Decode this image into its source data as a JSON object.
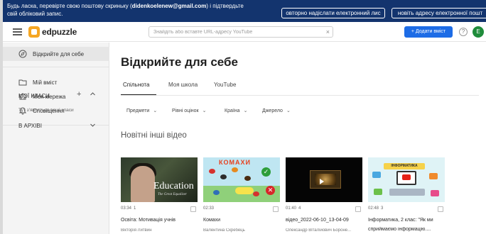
{
  "banner": {
    "text_before": "Будь ласка, перевірте свою поштову скриньку (",
    "email": "didenkoelenew@gmail.com",
    "text_after": ") і підтвердьте свій обліковий запис.",
    "resend_button": "овторно надіслати електронний лис",
    "change_button": "новіть адресу електронної пошт"
  },
  "header": {
    "logo_text": "edpuzzle",
    "search_placeholder": "Знайдіть або вставте URL-адресу YouTube",
    "search_clear": "×",
    "add_content_button": "+ Додати вміст",
    "help": "?",
    "avatar_letter": "E"
  },
  "sidebar": {
    "discover": "Відкрийте для себе",
    "my_content": "Мій вміст",
    "my_network": "Моя мережа",
    "notifications": "Сповіщення",
    "classes_title": "МОЇ КЛАСИ",
    "classes_plus": "+",
    "classes_hint": "Тут з'являться ваші класи",
    "archive": "В АРХІВІ"
  },
  "main": {
    "title": "Відкрийте для себе",
    "tabs": [
      {
        "label": "Спільнота"
      },
      {
        "label": "Моя школа"
      },
      {
        "label": "YouTube"
      }
    ],
    "filters": [
      {
        "label": "Предмети"
      },
      {
        "label": "Рівні оцінок"
      },
      {
        "label": "Країна"
      },
      {
        "label": "Джерело"
      }
    ],
    "section_title": "Новітні інші відео"
  },
  "videos": [
    {
      "duration": "03:34",
      "count": "1",
      "title": "Освіта: Мотивація учнів",
      "author": "Вікторія Литвин",
      "thumb_text": "Education",
      "thumb_sub": "The Great Equalizer"
    },
    {
      "duration": "02:33",
      "count": "",
      "title": "Комахи",
      "author": "Валентина Скребець",
      "thumb_text": "КОМАХИ"
    },
    {
      "duration": "01:40",
      "count": "4",
      "title": "відео_2022-06-10_13-04-09",
      "author": "Олександр Віталійович Бороне..."
    },
    {
      "duration": "02:48",
      "count": "3",
      "title": "Інформатика, 2 клас: \"Як ми",
      "author": "сприймаємо інформацію....",
      "thumb_text": "ІНФОРМАТИКА"
    }
  ],
  "colors": {
    "banner_bg": "#13346e",
    "primary_button": "#1d6ce6",
    "avatar": "#1f8c3b",
    "logo_accent": "#f5a623"
  }
}
